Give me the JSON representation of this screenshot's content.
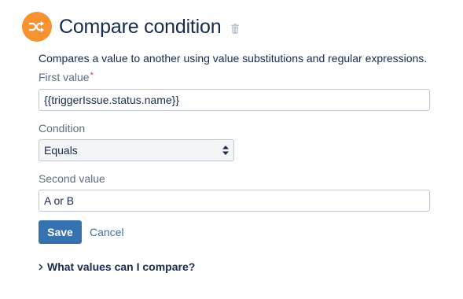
{
  "header": {
    "title": "Compare condition",
    "icon": "shuffle-icon",
    "delete_icon": "trash-icon"
  },
  "description": "Compares a value to another using value substitutions and regular expressions.",
  "form": {
    "first_value": {
      "label": "First value",
      "required_marker": "*",
      "value": "{{triggerIssue.status.name}}"
    },
    "condition": {
      "label": "Condition",
      "selected": "Equals"
    },
    "second_value": {
      "label": "Second value",
      "value": "A or B"
    }
  },
  "actions": {
    "save_label": "Save",
    "cancel_label": "Cancel"
  },
  "help": {
    "expander_label": "What values can I compare?",
    "chevron_icon": "chevron-right-icon"
  },
  "colors": {
    "accent_orange": "#f79232",
    "primary_blue": "#3572b0",
    "required_red": "#d04437",
    "text": "#172b4d",
    "muted_text": "#5e6c84"
  }
}
